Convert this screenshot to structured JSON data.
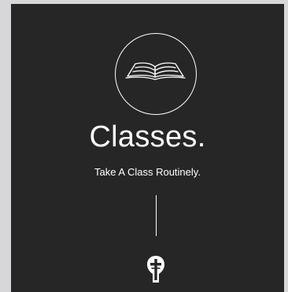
{
  "header": {
    "title": "Classes.",
    "subtitle": "Take A Class Routinely."
  },
  "icons": {
    "hero": "open-book-icon",
    "footer": "cross-logo-icon"
  },
  "colors": {
    "page_background": "#d7d7d9",
    "panel_background": "#262626",
    "foreground": "#ffffff"
  }
}
